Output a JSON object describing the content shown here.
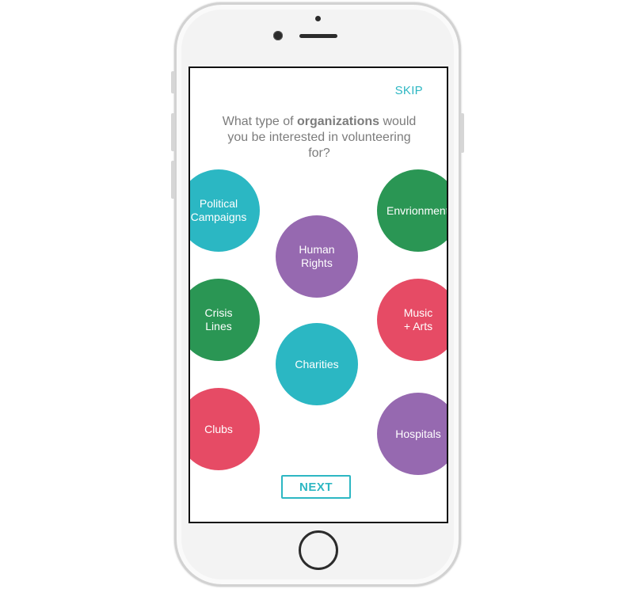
{
  "header": {
    "skip_label": "SKIP"
  },
  "question": {
    "part1": "What type of ",
    "bold": "organizations",
    "part2": " would you be interested in volunteering for?"
  },
  "options": [
    {
      "label": "Political\nCampaigns",
      "color": "#2bb7c3"
    },
    {
      "label": "Envrionment",
      "color": "#2a9654"
    },
    {
      "label": "Human\nRights",
      "color": "#9669b0"
    },
    {
      "label": "Crisis\nLines",
      "color": "#2a9654"
    },
    {
      "label": "Music\n+ Arts",
      "color": "#e64b65"
    },
    {
      "label": "Charities",
      "color": "#2bb7c3"
    },
    {
      "label": "Clubs",
      "color": "#e64b65"
    },
    {
      "label": "Hospitals",
      "color": "#9669b0"
    }
  ],
  "footer": {
    "next_label": "NEXT"
  },
  "colors": {
    "accent": "#2db7c3"
  }
}
